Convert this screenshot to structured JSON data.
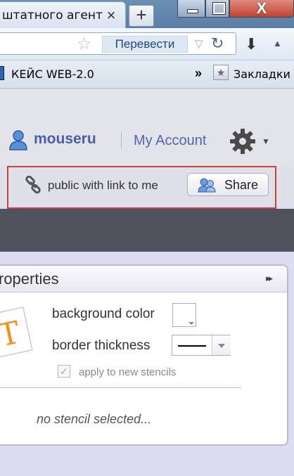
{
  "browser": {
    "tab_title": "штатного агент",
    "tab_close": "×",
    "new_tab": "+",
    "translate_label": "Перевести",
    "bookmark_item": "КЕЙС WEB-2.0",
    "bookmarks_more": "»",
    "bookmarks_folder": "Закладки",
    "window_close": "X"
  },
  "header": {
    "username": "mouseru",
    "account_link": "My Account"
  },
  "share_bar": {
    "visibility_text": "public with link to me",
    "share_label": "Share"
  },
  "properties": {
    "title": "roperties",
    "background_color_label": "background color",
    "border_thickness_label": "border thickness",
    "apply_label": "apply to new stencils",
    "apply_checked": true,
    "empty_text": "no stencil selected..."
  },
  "colors": {
    "accent": "#4b5ea9",
    "highlight_border": "#c4433a",
    "dark_band": "#50515c"
  }
}
